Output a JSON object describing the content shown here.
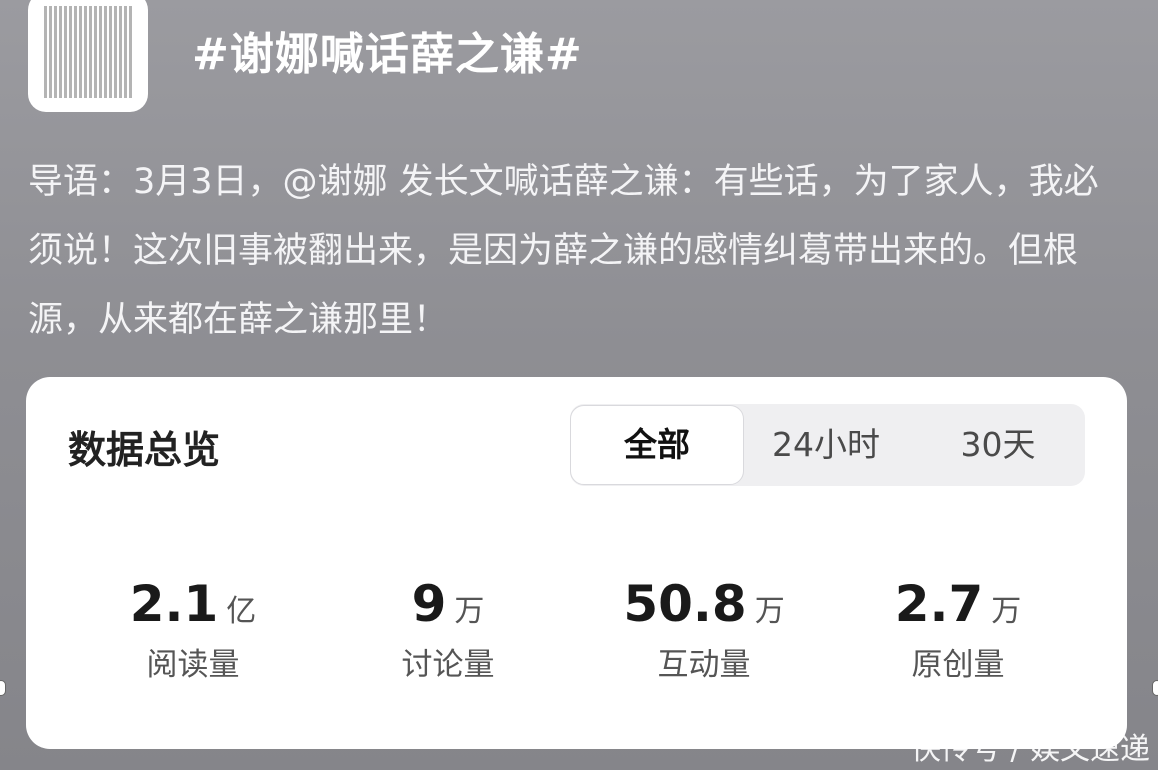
{
  "topic": {
    "thumbnail_icon": "topic-cover-image",
    "title": "#谢娜喊话薛之谦#"
  },
  "intro": {
    "text": "导语：3月3日，@谢娜 发长文喊话薛之谦：有些话，为了家人，我必须说！这次旧事被翻出来，是因为薛之谦的感情纠葛带出来的。但根源，从来都在薛之谦那里！"
  },
  "overview": {
    "title": "数据总览",
    "tabs": [
      {
        "label": "全部",
        "active": true
      },
      {
        "label": "24小时",
        "active": false
      },
      {
        "label": "30天",
        "active": false
      }
    ],
    "stats": [
      {
        "value": "2.1",
        "unit": "亿",
        "label": "阅读量"
      },
      {
        "value": "9",
        "unit": "万",
        "label": "讨论量"
      },
      {
        "value": "50.8",
        "unit": "万",
        "label": "互动量"
      },
      {
        "value": "2.7",
        "unit": "万",
        "label": "原创量"
      }
    ]
  },
  "watermark": "快传号 / 娱文速递",
  "colors": {
    "background": "#8e8e93",
    "card": "#ffffff",
    "segment_bg": "#efeff1"
  }
}
